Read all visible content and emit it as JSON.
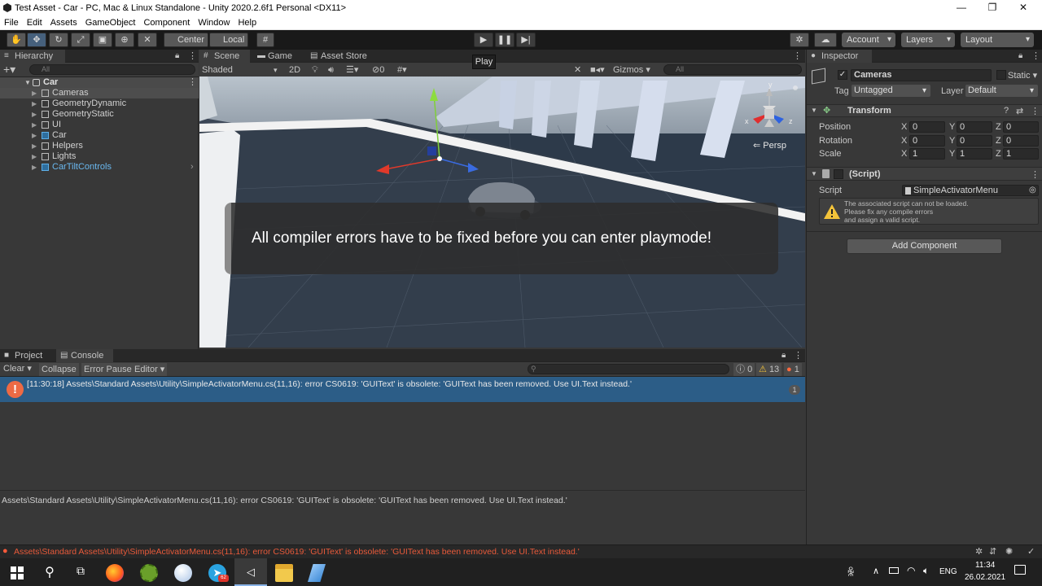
{
  "window": {
    "title": "Test Asset - Car - PC, Mac & Linux Standalone - Unity 2020.2.6f1 Personal <DX11>",
    "minimize": "—",
    "maximize": "❐",
    "close": "✕"
  },
  "menu": [
    "File",
    "Edit",
    "Assets",
    "GameObject",
    "Component",
    "Window",
    "Help"
  ],
  "toolbar": {
    "center": "Center",
    "local": "Local",
    "account": "Account",
    "layers": "Layers",
    "layout": "Layout",
    "play_tooltip": "Play"
  },
  "hierarchy": {
    "tab": "Hierarchy",
    "search_placeholder": "All",
    "scene_root": "Car",
    "items": [
      {
        "label": "Cameras",
        "prefab": false
      },
      {
        "label": "GeometryDynamic",
        "prefab": false
      },
      {
        "label": "GeometryStatic",
        "prefab": false
      },
      {
        "label": "UI",
        "prefab": false
      },
      {
        "label": "Car",
        "prefab": true
      },
      {
        "label": "Helpers",
        "prefab": false
      },
      {
        "label": "Lights",
        "prefab": false
      },
      {
        "label": "CarTiltControls",
        "prefab": true
      }
    ]
  },
  "scene": {
    "tabs": [
      "Scene",
      "Game",
      "Asset Store"
    ],
    "shading": "Shaded",
    "mode2d": "2D",
    "fx_count": "0",
    "gizmos": "Gizmos",
    "search_placeholder": "All",
    "persp": "Persp",
    "overlay_message": "All compiler errors have to be fixed before you can enter playmode!"
  },
  "inspector": {
    "tab": "Inspector",
    "object_name": "Cameras",
    "static_label": "Static",
    "tag_label": "Tag",
    "tag_value": "Untagged",
    "layer_label": "Layer",
    "layer_value": "Default",
    "transform": {
      "title": "Transform",
      "position_label": "Position",
      "rotation_label": "Rotation",
      "scale_label": "Scale",
      "position": [
        "0",
        "0",
        "0"
      ],
      "rotation": [
        "0",
        "0",
        "0"
      ],
      "scale": [
        "1",
        "1",
        "1"
      ]
    },
    "script": {
      "title": "(Script)",
      "label": "Script",
      "value": "SimpleActivatorMenu",
      "warning_line1": "The associated script can not be loaded.",
      "warning_line2": "Please fix any compile errors",
      "warning_line3": "and assign a valid script."
    },
    "add_component": "Add Component"
  },
  "console": {
    "tabs": [
      "Project",
      "Console"
    ],
    "clear": "Clear",
    "collapse": "Collapse",
    "error_pause": "Error Pause",
    "editor": "Editor",
    "info_count": "0",
    "warn_count": "13",
    "error_count": "1",
    "entry": "[11:30:18] Assets\\Standard Assets\\Utility\\SimpleActivatorMenu.cs(11,16): error CS0619: 'GUIText' is obsolete: 'GUIText has been removed. Use UI.Text instead.'",
    "entry_count": "1",
    "detail": "Assets\\Standard Assets\\Utility\\SimpleActivatorMenu.cs(11,16): error CS0619: 'GUIText' is obsolete: 'GUIText has been removed. Use UI.Text instead.'"
  },
  "status": {
    "message": "Assets\\Standard Assets\\Utility\\SimpleActivatorMenu.cs(11,16): error CS0619: 'GUIText' is obsolete: 'GUIText has been removed. Use UI.Text instead.'"
  },
  "taskbar": {
    "lang": "ENG",
    "time": "11:34",
    "date": "26.02.2021",
    "badge": "62"
  }
}
